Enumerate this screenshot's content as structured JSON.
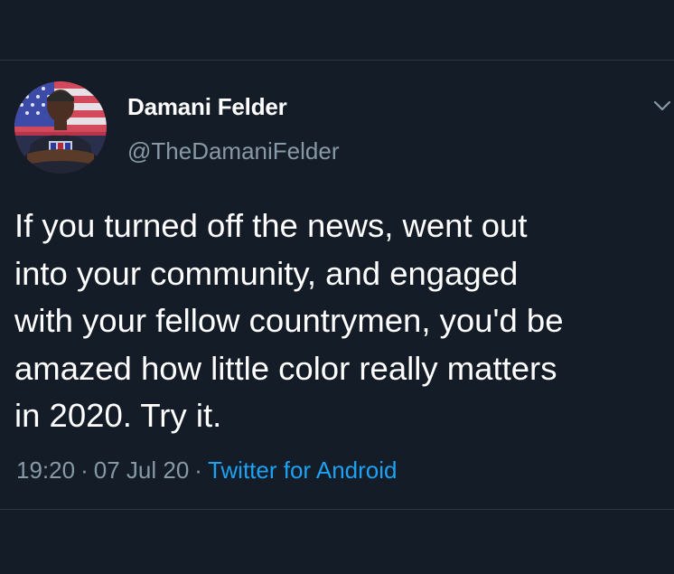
{
  "tweet": {
    "author": {
      "name": "Damani Felder",
      "handle": "@TheDamaniFelder",
      "avatar_icon": "profile-photo"
    },
    "menu_icon": "chevron-down-icon",
    "text_lines": [
      "If you turned off the news, went out",
      "into your community, and engaged",
      "with your fellow countrymen, you'd be",
      "amazed how little color really matters",
      "in 2020. Try it."
    ],
    "time": "19:20",
    "date": "07 Jul 20",
    "separator": "·",
    "source": "Twitter for Android"
  },
  "colors": {
    "background": "#141c27",
    "primary_text": "#ffffff",
    "secondary_text": "#8899a6",
    "link": "#1da1f2",
    "divider": "#2c3846"
  }
}
